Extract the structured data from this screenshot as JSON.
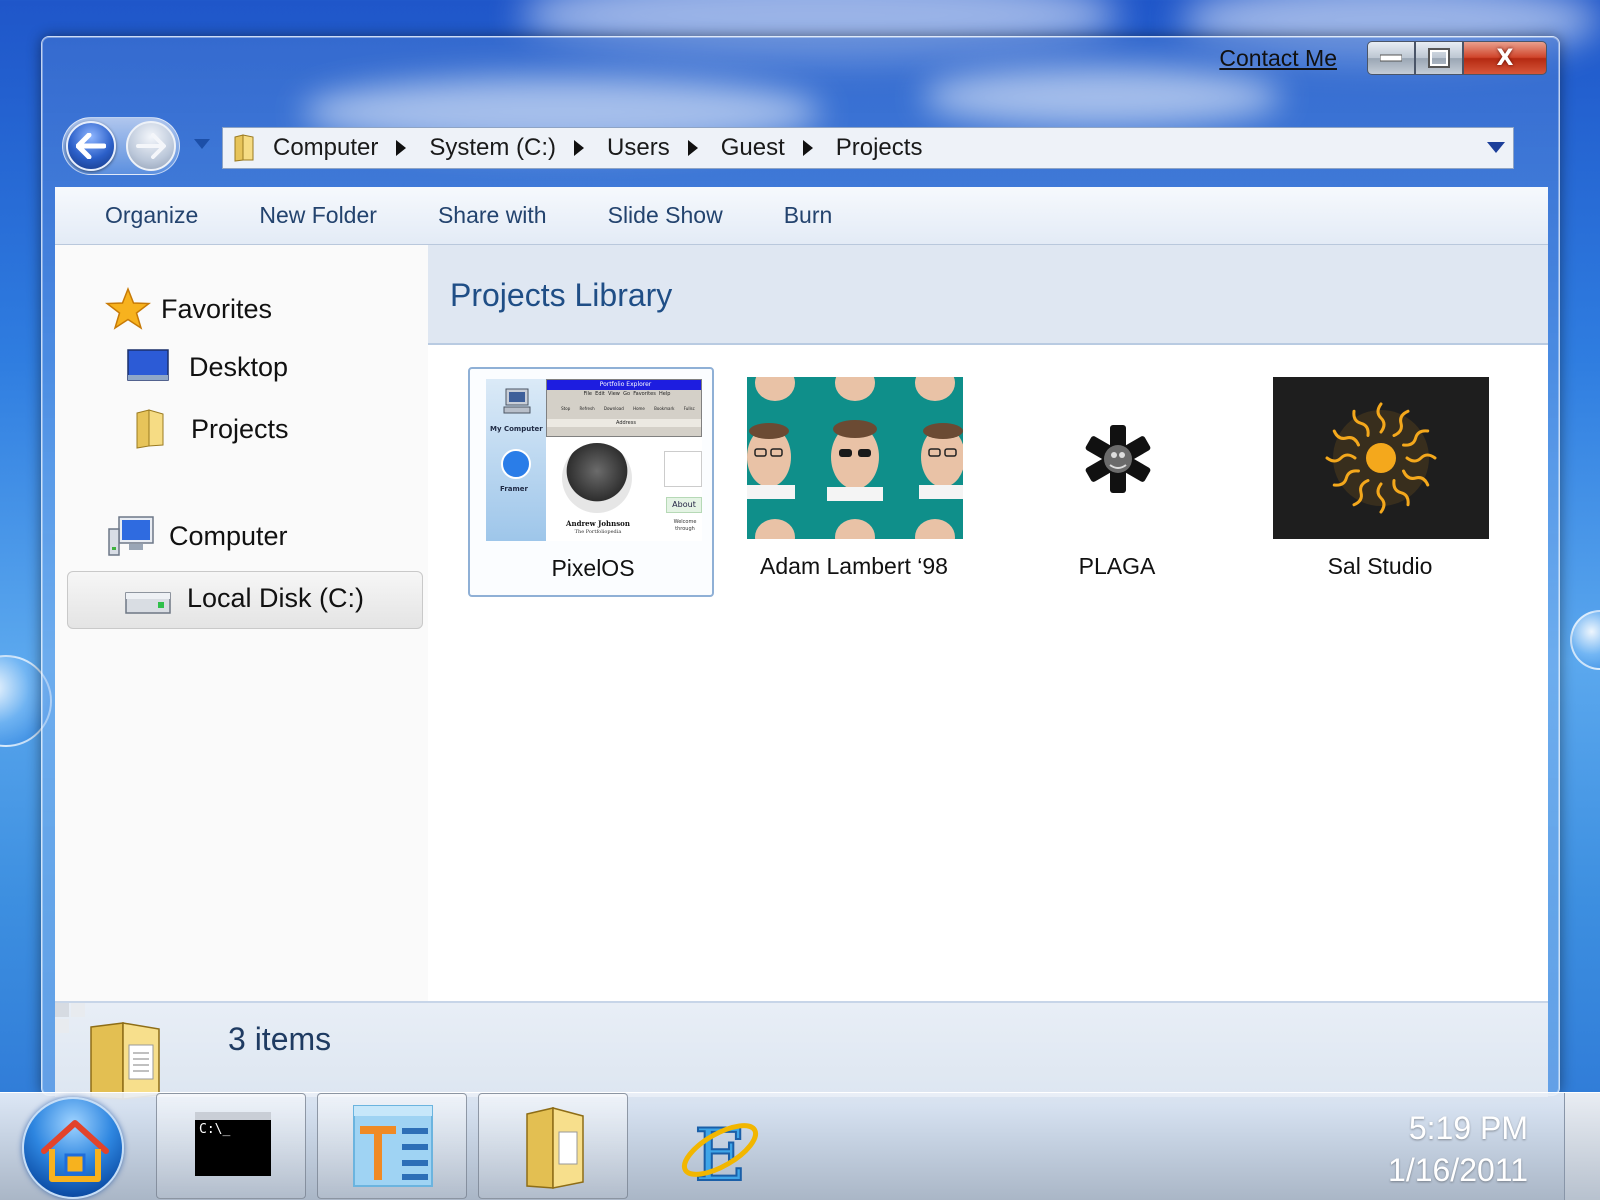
{
  "window": {
    "contact_label": "Contact Me",
    "close_glyph": "X"
  },
  "address": {
    "crumbs": [
      "Computer",
      "System (C:)",
      "Users",
      "Guest",
      "Projects"
    ]
  },
  "toolbar": {
    "items": [
      "Organize",
      "New Folder",
      "Share with",
      "Slide Show",
      "Burn"
    ]
  },
  "sidebar": {
    "favorites_label": "Favorites",
    "desktop_label": "Desktop",
    "projects_label": "Projects",
    "computer_label": "Computer",
    "local_disk_label": "Local Disk (C:)"
  },
  "library": {
    "title": "Projects Library",
    "items": [
      {
        "label": "PixelOS",
        "selected": true
      },
      {
        "label": "Adam Lambert ‘98",
        "selected": false
      },
      {
        "label": "PLAGA",
        "selected": false
      },
      {
        "label": "Sal Studio",
        "selected": false
      }
    ],
    "pixelos_thumb": {
      "window_title": "Portfolio Explorer",
      "menu": [
        "File",
        "Edit",
        "View",
        "Go",
        "Favorites",
        "Help"
      ],
      "tools": [
        "Stop",
        "Refresh",
        "Download",
        "Home",
        "Bookmark",
        "Fullsc"
      ],
      "address_label": "Address",
      "icon_mycomputer": "My Computer",
      "icon_framer": "Framer",
      "person_name": "Andrew Johnson",
      "person_sub": "The Portfoliopedia",
      "about_label": "About",
      "welcome_text": "Welcome through"
    }
  },
  "status": {
    "count_text": "3 items"
  },
  "taskbar": {
    "time": "5:19 PM",
    "date": "1/16/2011",
    "terminal_prompt": "C:\\_"
  },
  "colors": {
    "accent_text": "#1f4e86",
    "toolbar_text": "#23436e",
    "close_red": "#c83b22",
    "teal_thumb": "#0f8f8a",
    "sun_orange": "#f4a81c"
  }
}
